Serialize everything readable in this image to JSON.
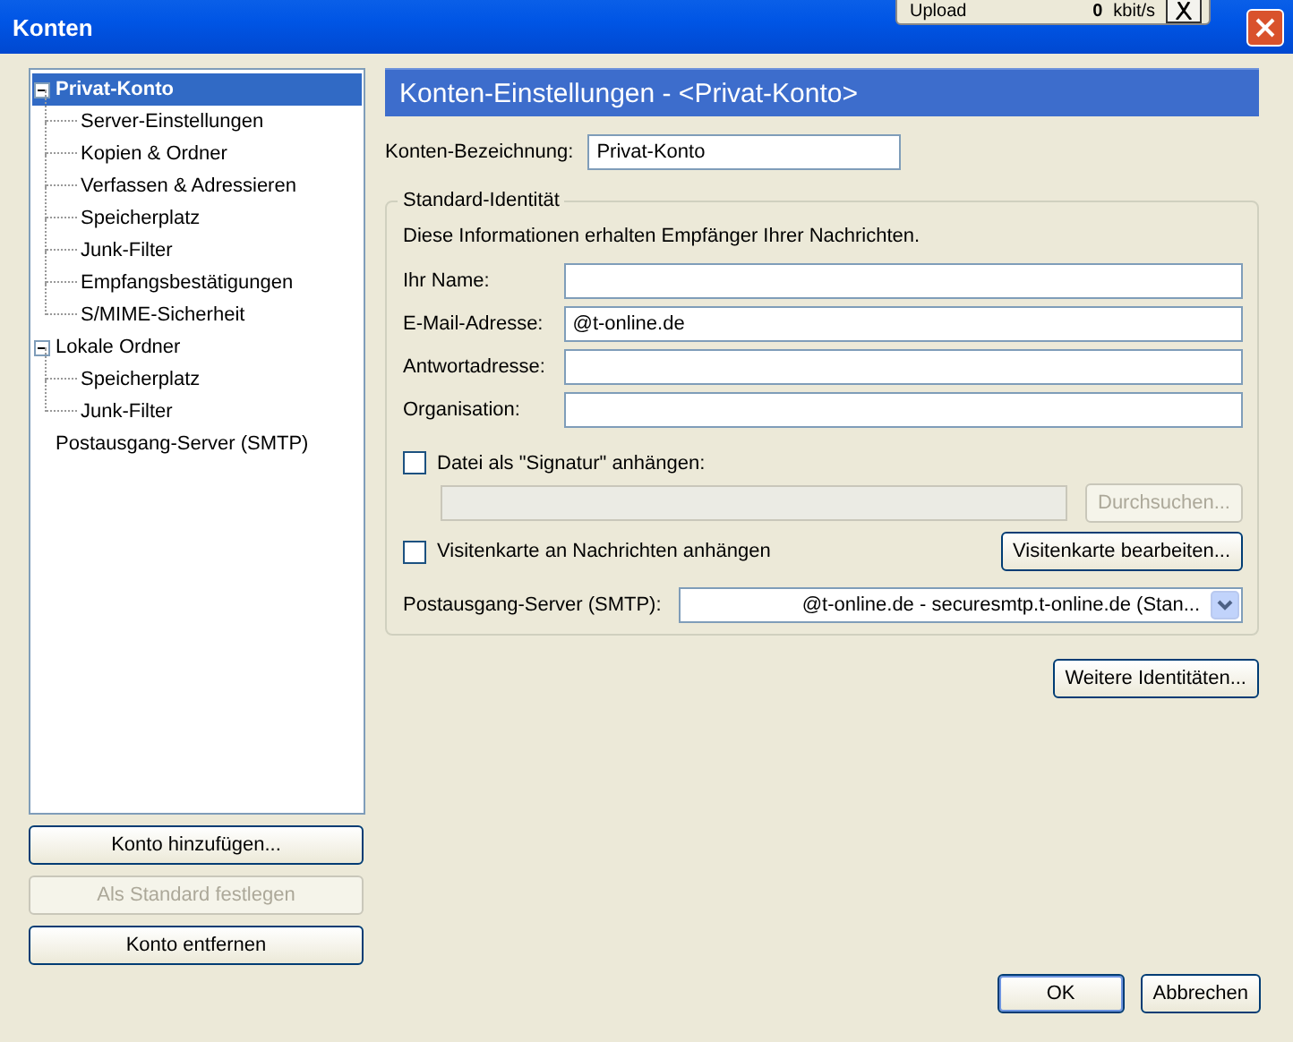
{
  "window": {
    "title": "Konten"
  },
  "overlay_panel": {
    "label": "Upload",
    "value": "0",
    "unit": "kbit/s"
  },
  "account_tree": [
    {
      "label": "Privat-Konto",
      "selected": true,
      "expanded": true,
      "children": [
        {
          "label": "Server-Einstellungen",
          "selected": false
        },
        {
          "label": "Kopien & Ordner",
          "selected": false
        },
        {
          "label": "Verfassen & Adressieren",
          "selected": false
        },
        {
          "label": "Speicherplatz",
          "selected": false
        },
        {
          "label": "Junk-Filter",
          "selected": false
        },
        {
          "label": "Empfangsbestätigungen",
          "selected": false
        },
        {
          "label": "S/MIME-Sicherheit",
          "selected": false
        }
      ]
    },
    {
      "label": "Lokale Ordner",
      "selected": false,
      "expanded": true,
      "children": [
        {
          "label": "Speicherplatz",
          "selected": false
        },
        {
          "label": "Junk-Filter",
          "selected": false
        }
      ]
    },
    {
      "label": "Postausgang-Server (SMTP)",
      "selected": false
    }
  ],
  "account_buttons": [
    {
      "label": "Konto hinzufügen...",
      "disabled": false
    },
    {
      "label": "Als Standard festlegen",
      "disabled": true
    },
    {
      "label": "Konto entfernen",
      "disabled": false
    }
  ],
  "panel": {
    "title": "Konten-Einstellungen - <Privat-Konto>",
    "account_name": {
      "label": "Konten-Bezeichnung:",
      "value": "Privat-Konto"
    },
    "identity": {
      "legend": "Standard-Identität",
      "description": "Diese Informationen erhalten Empfänger Ihrer Nachrichten.",
      "fields": [
        {
          "label": "Ihr Name:"
        },
        {
          "label": "E-Mail-Adresse:",
          "value": "@t-online.de"
        },
        {
          "label": "Antwortadresse:"
        },
        {
          "label": "Organisation:"
        }
      ],
      "signature": {
        "label": "Datei als \"Signatur\" anhängen:",
        "checked": false,
        "file_field": {
          "disabled": true
        },
        "browse_button": {
          "label": "Durchsuchen...",
          "disabled": true
        }
      },
      "vcard": {
        "label": "Visitenkarte an Nachrichten anhängen",
        "checked": false,
        "edit_button": {
          "label": "Visitenkarte bearbeiten..."
        }
      },
      "smtp": {
        "label": "Postausgang-Server (SMTP):",
        "value": "@t-online.de - securesmtp.t-online.de (Stan..."
      }
    },
    "more_identities_button": {
      "label": "Weitere Identitäten..."
    }
  },
  "dialog_buttons": [
    {
      "label": "OK",
      "default": true
    },
    {
      "label": "Abbrechen",
      "default": false
    }
  ]
}
